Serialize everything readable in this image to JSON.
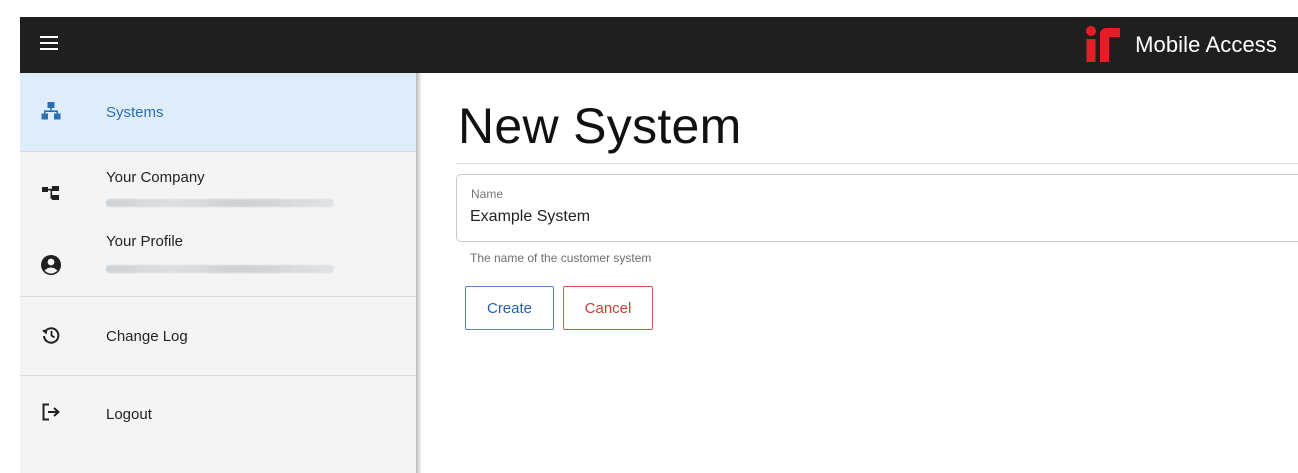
{
  "app": {
    "title": "Mobile Access",
    "logo": "ir-logo",
    "accent_color": "#e31e24"
  },
  "sidebar": {
    "items": [
      {
        "label": "Systems",
        "icon": "sitemap-icon",
        "active": true
      },
      {
        "label": "Your Company",
        "icon": "org-chart-icon"
      },
      {
        "label": "Your Profile",
        "icon": "account-circle-icon"
      },
      {
        "label": "Change Log",
        "icon": "history-icon"
      },
      {
        "label": "Logout",
        "icon": "logout-icon"
      }
    ]
  },
  "main": {
    "title": "New System",
    "name_field": {
      "label": "Name",
      "value": "Example System",
      "helper": "The name of the customer system"
    },
    "buttons": {
      "create": "Create",
      "cancel": "Cancel"
    }
  }
}
